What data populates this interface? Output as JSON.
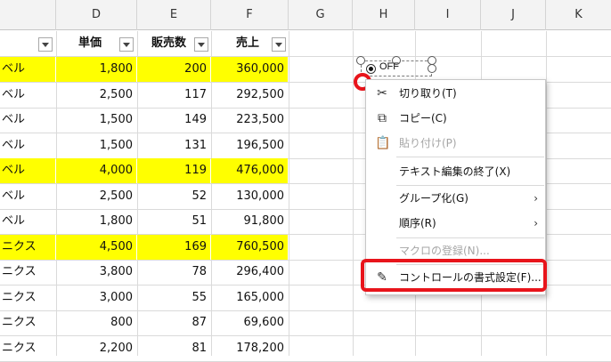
{
  "columns": [
    "D",
    "E",
    "F",
    "G",
    "H",
    "I",
    "J",
    "K"
  ],
  "header_row": {
    "col_c": "",
    "unit_price": "単価",
    "units_sold": "販売数",
    "sales": "売上"
  },
  "rows": [
    {
      "c": "ベル",
      "d": "1,800",
      "e": "200",
      "f": "360,000",
      "highlight": true
    },
    {
      "c": "ベル",
      "d": "2,500",
      "e": "117",
      "f": "292,500",
      "highlight": false
    },
    {
      "c": "ベル",
      "d": "1,500",
      "e": "149",
      "f": "223,500",
      "highlight": false
    },
    {
      "c": "ベル",
      "d": "1,500",
      "e": "131",
      "f": "196,500",
      "highlight": false
    },
    {
      "c": "ベル",
      "d": "4,000",
      "e": "119",
      "f": "476,000",
      "highlight": true
    },
    {
      "c": "ベル",
      "d": "2,500",
      "e": "52",
      "f": "130,000",
      "highlight": false
    },
    {
      "c": "ベル",
      "d": "1,800",
      "e": "51",
      "f": "91,800",
      "highlight": false
    },
    {
      "c": "ニクス",
      "d": "4,500",
      "e": "169",
      "f": "760,500",
      "highlight": true
    },
    {
      "c": "ニクス",
      "d": "3,800",
      "e": "78",
      "f": "296,400",
      "highlight": false
    },
    {
      "c": "ニクス",
      "d": "3,000",
      "e": "55",
      "f": "165,000",
      "highlight": false
    },
    {
      "c": "ニクス",
      "d": "800",
      "e": "87",
      "f": "69,600",
      "highlight": false
    },
    {
      "c": "ニクス",
      "d": "2,200",
      "e": "81",
      "f": "178,200",
      "highlight": false
    }
  ],
  "control": {
    "label": "OFF"
  },
  "context_menu": {
    "cut": "切り取り(T)",
    "copy": "コピー(C)",
    "paste": "貼り付け(P)",
    "exit_text_edit": "テキスト編集の終了(X)",
    "group": "グループ化(G)",
    "order": "順序(R)",
    "assign_macro": "マクロの登録(N)...",
    "format_control": "コントロールの書式設定(F)..."
  },
  "colors": {
    "highlight": "#ffff00",
    "annotation_red": "#e8141b"
  }
}
